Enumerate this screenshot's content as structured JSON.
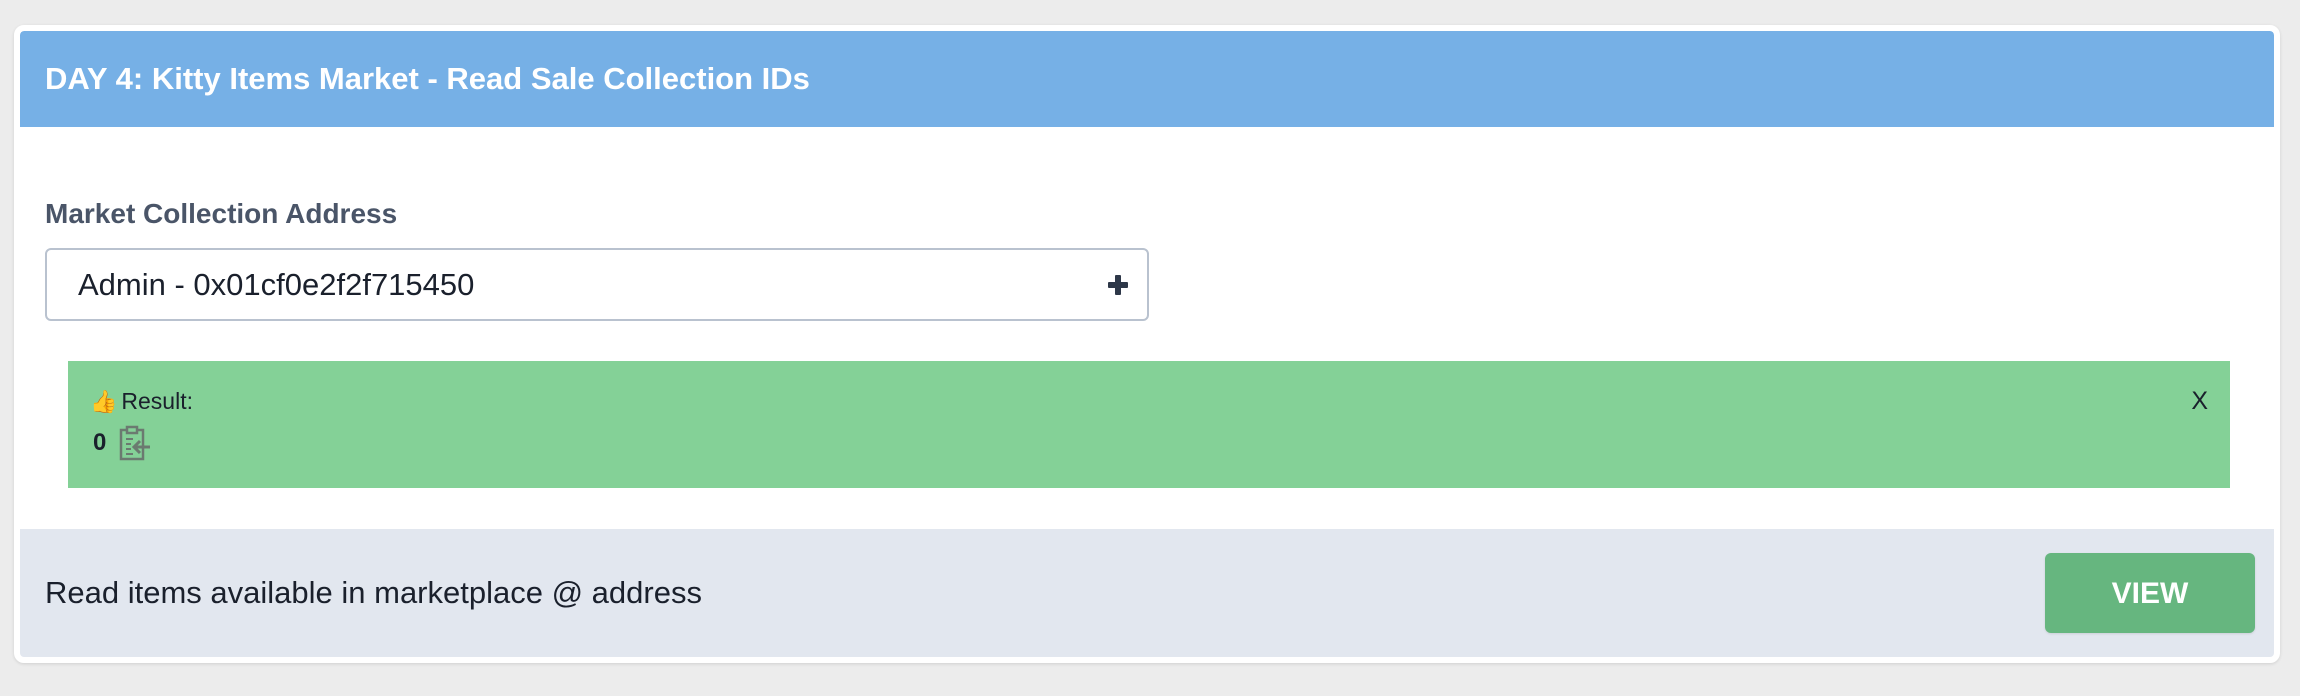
{
  "card": {
    "title": "DAY 4: Kitty Items Market - Read Sale Collection IDs"
  },
  "form": {
    "field_label": "Market Collection Address",
    "selected_value": "Admin - 0x01cf0e2f2f715450",
    "add_icon": "plus-icon"
  },
  "result": {
    "icon": "thumbs-up-icon",
    "icon_glyph": "👍",
    "label": "Result:",
    "value": "0",
    "copy_icon": "clipboard-icon",
    "close_label": "X"
  },
  "footer": {
    "description": "Read items available in marketplace @ address",
    "view_label": "VIEW"
  },
  "colors": {
    "header": "#76b0e6",
    "result_bg": "#84d197",
    "footer_bg": "#e2e7ef",
    "button": "#66b67f",
    "page_bg": "#ececec"
  }
}
